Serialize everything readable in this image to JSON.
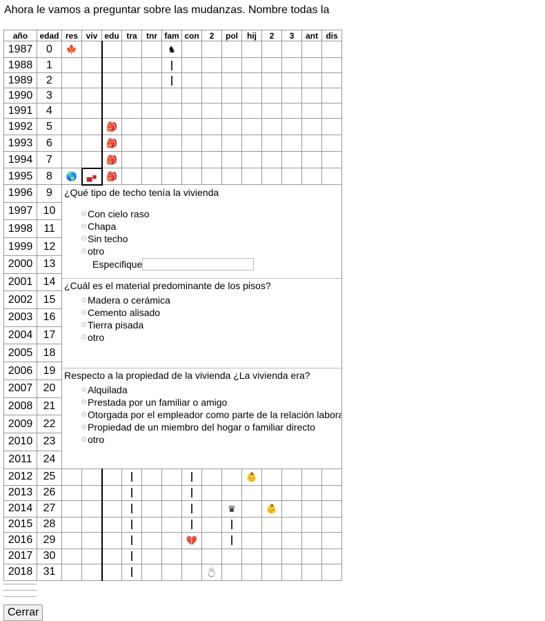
{
  "intro": "Ahora le vamos a preguntar sobre las mudanzas. Nombre todas la",
  "columns": [
    "año",
    "edad",
    "res",
    "viv",
    "edu",
    "tra",
    "tnr",
    "fam",
    "con",
    "2",
    "pol",
    "hij",
    "2",
    "3",
    "ant",
    "dis"
  ],
  "years": [
    "1987",
    "1988",
    "1989",
    "1990",
    "1991",
    "1992",
    "1993",
    "1994",
    "1995",
    "1996",
    "1997",
    "1998",
    "1999",
    "2000",
    "2001",
    "2002",
    "2003",
    "2004",
    "2005",
    "2006",
    "2007",
    "2008",
    "2009",
    "2010",
    "2011",
    "2012",
    "2013",
    "2014",
    "2015",
    "2016",
    "2017",
    "2018"
  ],
  "ages": [
    "0",
    "1",
    "2",
    "3",
    "4",
    "5",
    "6",
    "7",
    "8",
    "9",
    "10",
    "11",
    "12",
    "13",
    "14",
    "15",
    "16",
    "17",
    "18",
    "19",
    "20",
    "21",
    "22",
    "23",
    "24",
    "25",
    "26",
    "27",
    "28",
    "29",
    "30",
    "31"
  ],
  "icons": {
    "canada": "🍁",
    "globe": "🌎",
    "truck": "▄■",
    "backpack": "🎒",
    "knight": "♞",
    "baby": "👶",
    "crown": "♛",
    "broken_heart": "💔",
    "ring": "💍"
  },
  "q1": {
    "title": "¿Qué tipo de techo tenía la vivienda",
    "options": [
      "Con cielo raso",
      "Chapa",
      "Sin techo",
      "otro"
    ],
    "specify_label": "Especifique",
    "specify_value": ""
  },
  "q2": {
    "title": "¿Cuál es el material predominante de los pisos?",
    "options": [
      "Madera o cerámica",
      "Cemento alisado",
      "Tierra pisada",
      "otro"
    ]
  },
  "q3": {
    "title": "Respecto a la propiedad de la vivienda ¿La vivienda era?",
    "options": [
      "Alquilada",
      "Prestada por un familiar o amigo",
      "Otorgada por el empleador como parte de la relación laboral",
      "Propiedad de un miembro del hogar o familiar directo",
      "otro"
    ]
  },
  "close_label": "Cerrar"
}
